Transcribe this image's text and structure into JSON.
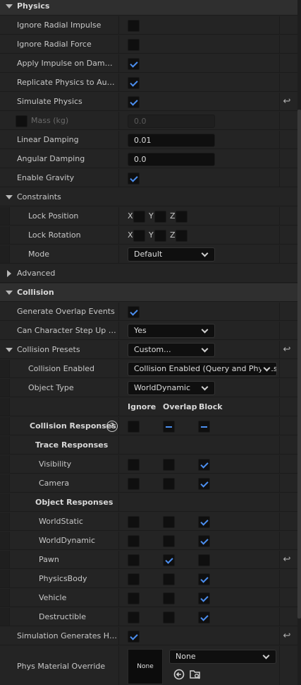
{
  "physics": {
    "title": "Physics",
    "ignore_radial_impulse": {
      "label": "Ignore Radial Impulse",
      "checked": false
    },
    "ignore_radial_force": {
      "label": "Ignore Radial Force",
      "checked": false
    },
    "apply_impulse_on_damage": {
      "label": "Apply Impulse on Damage",
      "checked": true
    },
    "replicate_physics": {
      "label": "Replicate Physics to Auton…",
      "checked": true
    },
    "simulate_physics": {
      "label": "Simulate Physics",
      "checked": true
    },
    "mass": {
      "label": "Mass (kg)",
      "value": "0.0"
    },
    "linear_damping": {
      "label": "Linear Damping",
      "value": "0.01"
    },
    "angular_damping": {
      "label": "Angular Damping",
      "value": "0.0"
    },
    "enable_gravity": {
      "label": "Enable Gravity",
      "checked": true
    }
  },
  "constraints": {
    "title": "Constraints",
    "lock_position": {
      "label": "Lock Position",
      "x": "X",
      "y": "Y",
      "z": "Z"
    },
    "lock_rotation": {
      "label": "Lock Rotation",
      "x": "X",
      "y": "Y",
      "z": "Z"
    },
    "mode": {
      "label": "Mode",
      "value": "Default"
    }
  },
  "advanced": {
    "title": "Advanced"
  },
  "collision": {
    "title": "Collision",
    "generate_overlap_events": {
      "label": "Generate Overlap Events",
      "checked": true
    },
    "can_character_step_up_on": {
      "label": "Can Character Step Up On",
      "value": "Yes"
    },
    "collision_presets": {
      "label": "Collision Presets",
      "value": "Custom..."
    },
    "collision_enabled": {
      "label": "Collision Enabled",
      "value": "Collision Enabled (Query and Physics)"
    },
    "object_type": {
      "label": "Object Type",
      "value": "WorldDynamic"
    },
    "columns": {
      "ignore": "Ignore",
      "overlap": "Overlap",
      "block": "Block"
    },
    "collision_responses": {
      "label": "Collision Responses",
      "help": "?"
    },
    "trace_responses": {
      "title": "Trace Responses",
      "items": [
        {
          "label": "Visibility",
          "response": "block"
        },
        {
          "label": "Camera",
          "response": "block"
        }
      ]
    },
    "object_responses": {
      "title": "Object Responses",
      "items": [
        {
          "label": "WorldStatic",
          "response": "block"
        },
        {
          "label": "WorldDynamic",
          "response": "block"
        },
        {
          "label": "Pawn",
          "response": "overlap"
        },
        {
          "label": "PhysicsBody",
          "response": "block"
        },
        {
          "label": "Vehicle",
          "response": "block"
        },
        {
          "label": "Destructible",
          "response": "block"
        }
      ]
    },
    "simulation_generates_hit_events": {
      "label": "Simulation Generates Hit E…",
      "checked": true
    },
    "phys_material_override": {
      "label": "Phys Material Override",
      "thumb": "None",
      "value": "None"
    }
  },
  "colors": {
    "accent": "#4c8ff0",
    "panel": "#242424",
    "category": "#2f2f2f"
  }
}
